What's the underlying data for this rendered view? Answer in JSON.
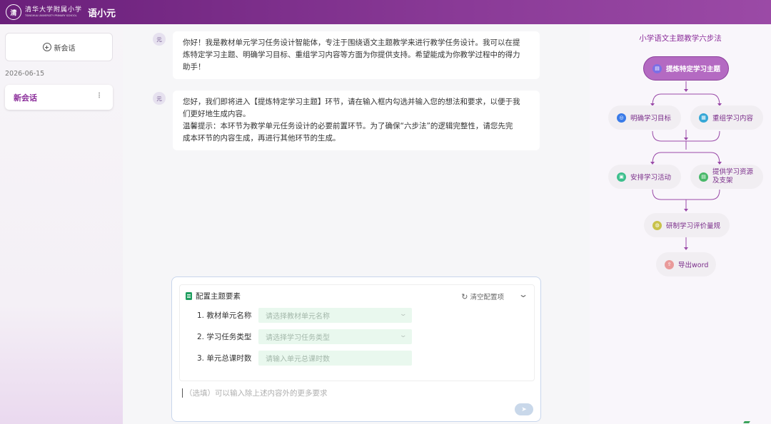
{
  "header": {
    "logo_seal": "清",
    "logo_cn": "清华大学附属小学",
    "logo_en": "TSINGHUA UNIVERSITY PRIMARY SCHOOL",
    "app_title": "语小元"
  },
  "sidebar": {
    "new_chat_label": "新会话",
    "date": "2026-06-15",
    "sessions": [
      {
        "label": "新会话",
        "more": "⋮"
      }
    ]
  },
  "chat": {
    "avatar_label": "元",
    "messages": [
      {
        "lines": [
          "你好！我是教材单元学习任务设计智能体，专注于围绕语文主题教学来进行教学任务设计。我可以在提",
          "炼特定学习主题、明确学习目标、重组学习内容等方面为你提供支持。希望能成为你教学过程中的得力",
          "助手！"
        ]
      },
      {
        "lines": [
          "您好，我们即将进入【提炼特定学习主题】环节，请在输入框内勾选并输入您的想法和要求，以便于我",
          "们更好地生成内容。",
          "温馨提示：本环节为教学单元任务设计的必要前置环节。为了确保“六步法”的逻辑完整性，请您先完",
          "成本环节的内容生成，再进行其他环节的生成。"
        ]
      }
    ]
  },
  "config": {
    "title": "配置主题要素",
    "clear_label": "清空配置项",
    "fields": [
      {
        "label": "1.  教材单元名称",
        "placeholder": "请选择教材单元名称",
        "has_dropdown": true
      },
      {
        "label": "2.  学习任务类型",
        "placeholder": "请选择学习任务类型",
        "has_dropdown": true
      },
      {
        "label": "3.  单元总课时数",
        "placeholder": "请输入单元总课时数",
        "has_dropdown": false
      }
    ],
    "extra_placeholder": "（选填）可以输入除上述内容外的更多要求"
  },
  "flow": {
    "title": "小学语文主题教学六步法",
    "steps": [
      {
        "label": "提炼特定学习主题",
        "icon": "document-icon",
        "color": "#7b6fe6",
        "active": true
      },
      {
        "label": "明确学习目标",
        "icon": "target-icon",
        "color": "#3a7be8",
        "active": false
      },
      {
        "label": "重组学习内容",
        "icon": "layers-icon",
        "color": "#36a7d6",
        "active": false
      },
      {
        "label": "安排学习活动",
        "icon": "activity-icon",
        "color": "#3cbf8c",
        "active": false
      },
      {
        "label": "提供学习资源\n及支架",
        "icon": "resource-icon",
        "color": "#49b86a",
        "active": false
      },
      {
        "label": "研制学习评价量规",
        "icon": "rubric-icon",
        "color": "#c9c24a",
        "active": false
      },
      {
        "label": "导出word",
        "icon": "export-icon",
        "color": "#e99a9a",
        "active": false
      }
    ]
  },
  "colors": {
    "brand": "#8b2d9a",
    "topbar": "#7a2a88",
    "field_bg": "#e9f8ee"
  }
}
